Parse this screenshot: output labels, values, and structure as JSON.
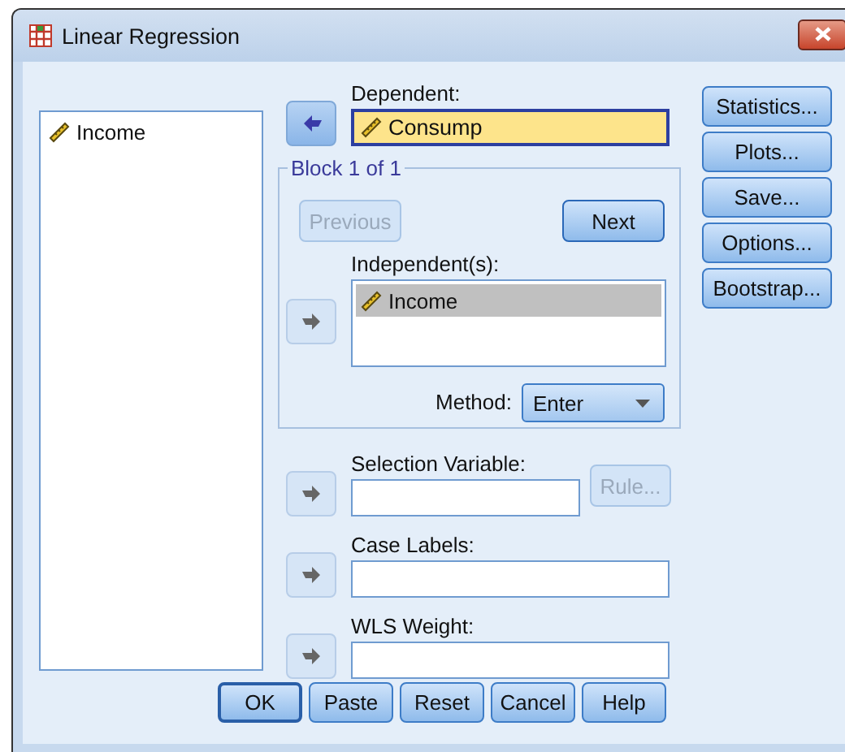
{
  "window": {
    "title": "Linear Regression"
  },
  "source_variables": [
    {
      "name": "Income",
      "selected": false
    }
  ],
  "dependent": {
    "label": "Dependent:",
    "value": "Consump",
    "arrow": {
      "points_back": true,
      "disabled": false
    }
  },
  "block": {
    "title": "Block 1 of 1",
    "previous_button": {
      "label": "Previous",
      "disabled": true
    },
    "next_button": {
      "label": "Next",
      "disabled": false
    },
    "independents": {
      "label": "Independent(s):",
      "arrow": {
        "points_back": false,
        "disabled": true
      },
      "items": [
        {
          "name": "Income",
          "selected": true
        }
      ]
    },
    "method": {
      "label": "Method:",
      "value": "Enter"
    }
  },
  "selection_variable": {
    "label": "Selection Variable:",
    "arrow": {
      "points_back": false,
      "disabled": true
    },
    "rule_button": {
      "label": "Rule...",
      "disabled": true
    }
  },
  "case_labels": {
    "label": "Case Labels:",
    "arrow": {
      "points_back": false,
      "disabled": true
    }
  },
  "wls_weight": {
    "label": "WLS Weight:",
    "arrow": {
      "points_back": false,
      "disabled": true
    }
  },
  "side_buttons": [
    "Statistics...",
    "Plots...",
    "Save...",
    "Options...",
    "Bootstrap..."
  ],
  "buttons": [
    {
      "label": "OK",
      "default": true
    },
    {
      "label": "Paste",
      "default": false
    },
    {
      "label": "Reset",
      "default": false
    },
    {
      "label": "Cancel",
      "default": false
    },
    {
      "label": "Help",
      "default": false
    }
  ]
}
